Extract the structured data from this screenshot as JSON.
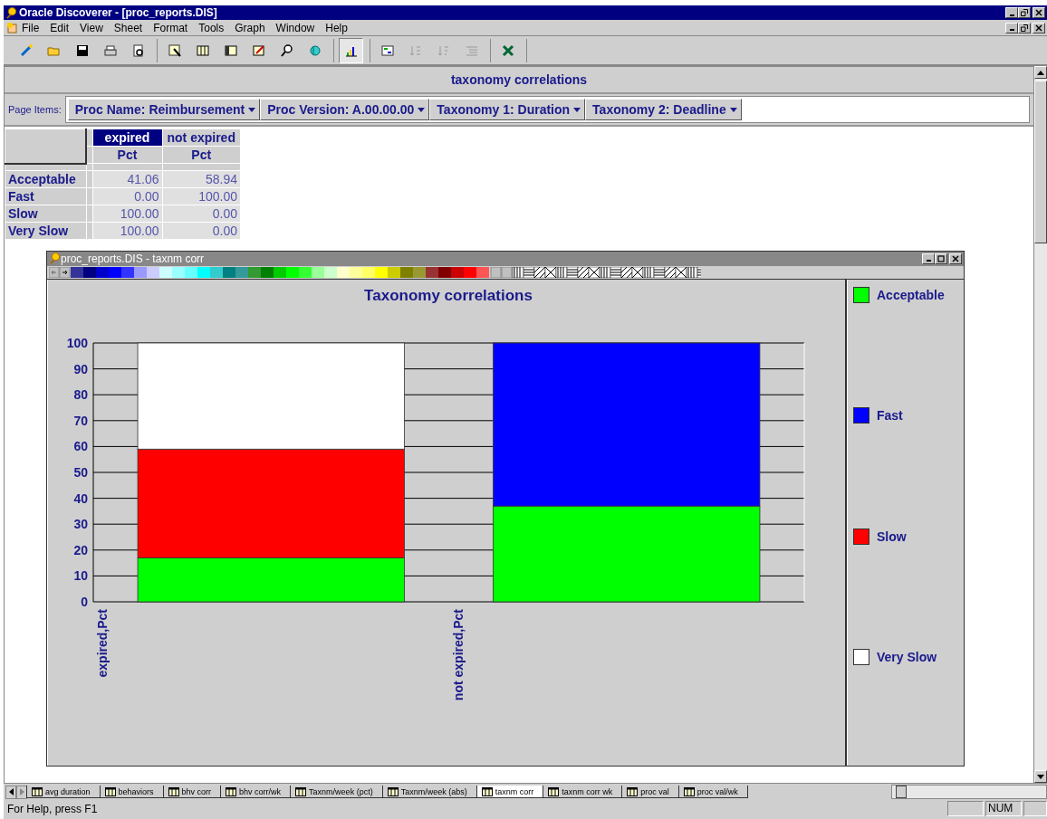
{
  "window": {
    "title": "Oracle Discoverer - [proc_reports.DIS]"
  },
  "menu": [
    "File",
    "Edit",
    "View",
    "Sheet",
    "Format",
    "Tools",
    "Graph",
    "Window",
    "Help"
  ],
  "sheet": {
    "title": "taxonomy correlations",
    "page_items_label": "Page Items:",
    "page_items": [
      "Proc Name: Reimbursement",
      "Proc Version: A.00.00.00",
      "Taxonomy 1: Duration",
      "Taxonomy 2: Deadline"
    ]
  },
  "table": {
    "columns": [
      {
        "label": "expired",
        "measure": "Pct",
        "selected": true
      },
      {
        "label": "not expired",
        "measure": "Pct",
        "selected": false
      }
    ],
    "rows": [
      {
        "label": "Acceptable",
        "cells": [
          "41.06",
          "58.94"
        ]
      },
      {
        "label": "Fast",
        "cells": [
          "0.00",
          "100.00"
        ]
      },
      {
        "label": "Slow",
        "cells": [
          "100.00",
          "0.00"
        ]
      },
      {
        "label": "Very Slow",
        "cells": [
          "100.00",
          "0.00"
        ]
      }
    ]
  },
  "chart_window": {
    "title": "proc_reports.DIS - taxnm corr",
    "chart_data": {
      "type": "bar",
      "stacked": true,
      "title": "Taxonomy correlations",
      "categories": [
        "expired,Pct",
        "not expired,Pct"
      ],
      "series": [
        {
          "name": "Acceptable",
          "color": "#00ff00",
          "values": [
            17,
            37
          ]
        },
        {
          "name": "Fast",
          "color": "#0000ff",
          "values": [
            0,
            63
          ]
        },
        {
          "name": "Slow",
          "color": "#ff0000",
          "values": [
            42,
            0
          ]
        },
        {
          "name": "Very Slow",
          "color": "#ffffff",
          "values": [
            41,
            0
          ]
        }
      ],
      "grid": true,
      "ylim": [
        0,
        100
      ],
      "yticks": [
        0,
        10,
        20,
        30,
        40,
        50,
        60,
        70,
        80,
        90,
        100
      ]
    }
  },
  "sheet_tabs": [
    {
      "label": "avg duration",
      "selected": false
    },
    {
      "label": "behaviors",
      "selected": false
    },
    {
      "label": "bhv corr",
      "selected": false
    },
    {
      "label": "bhv corr/wk",
      "selected": false
    },
    {
      "label": "Taxnm/week (pct)",
      "selected": false
    },
    {
      "label": "Taxnm/week  (abs)",
      "selected": false
    },
    {
      "label": "taxnm corr",
      "selected": true
    },
    {
      "label": "taxnm corr wk",
      "selected": false
    },
    {
      "label": "proc val",
      "selected": false
    },
    {
      "label": "proc val/wk",
      "selected": false
    }
  ],
  "status_bar": {
    "text": "For Help, press F1",
    "indicator": "NUM"
  }
}
